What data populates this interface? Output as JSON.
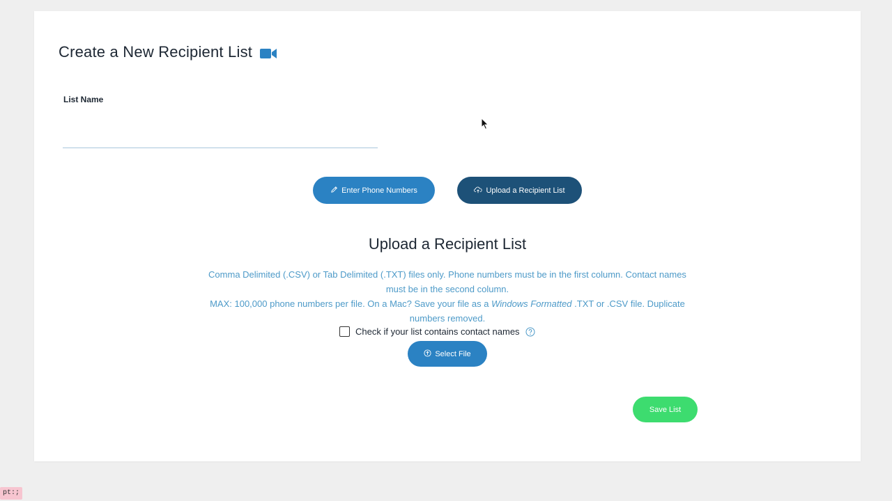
{
  "page": {
    "title": "Create a New Recipient List",
    "title_icon": "video-camera-icon"
  },
  "form": {
    "list_name_label": "List Name",
    "list_name_value": "",
    "list_name_placeholder": ""
  },
  "mode_buttons": {
    "enter_label": "Enter Phone Numbers",
    "enter_icon": "pencil-icon",
    "upload_label": "Upload a Recipient List",
    "upload_icon": "cloud-upload-icon"
  },
  "upload_section": {
    "heading": "Upload a Recipient List",
    "instructions_line1": "Comma Delimited (.CSV) or Tab Delimited (.TXT) files only. Phone numbers must be in the first column. Contact names must be in the second column.",
    "instructions_line2_pre": "MAX: 100,000 phone numbers per file. On a Mac? Save your file as a",
    "instructions_line2_em": "Windows Formatted",
    "instructions_line2_post": ".TXT or .CSV file. Duplicate numbers removed.",
    "checkbox_label": "Check if your list contains contact names",
    "checkbox_checked": false,
    "help_icon": "question-circle-icon",
    "select_file_label": "Select File",
    "select_file_icon": "upload-circle-icon"
  },
  "actions": {
    "save_label": "Save List"
  },
  "status_bar": {
    "text": "pt:;"
  },
  "colors": {
    "background": "#efefef",
    "card": "#ffffff",
    "primary_blue": "#2b82c3",
    "active_dark_blue": "#1d5178",
    "save_green": "#3ddc6f",
    "instruction_text": "#4d9ac8",
    "heading_text": "#1d2733"
  }
}
